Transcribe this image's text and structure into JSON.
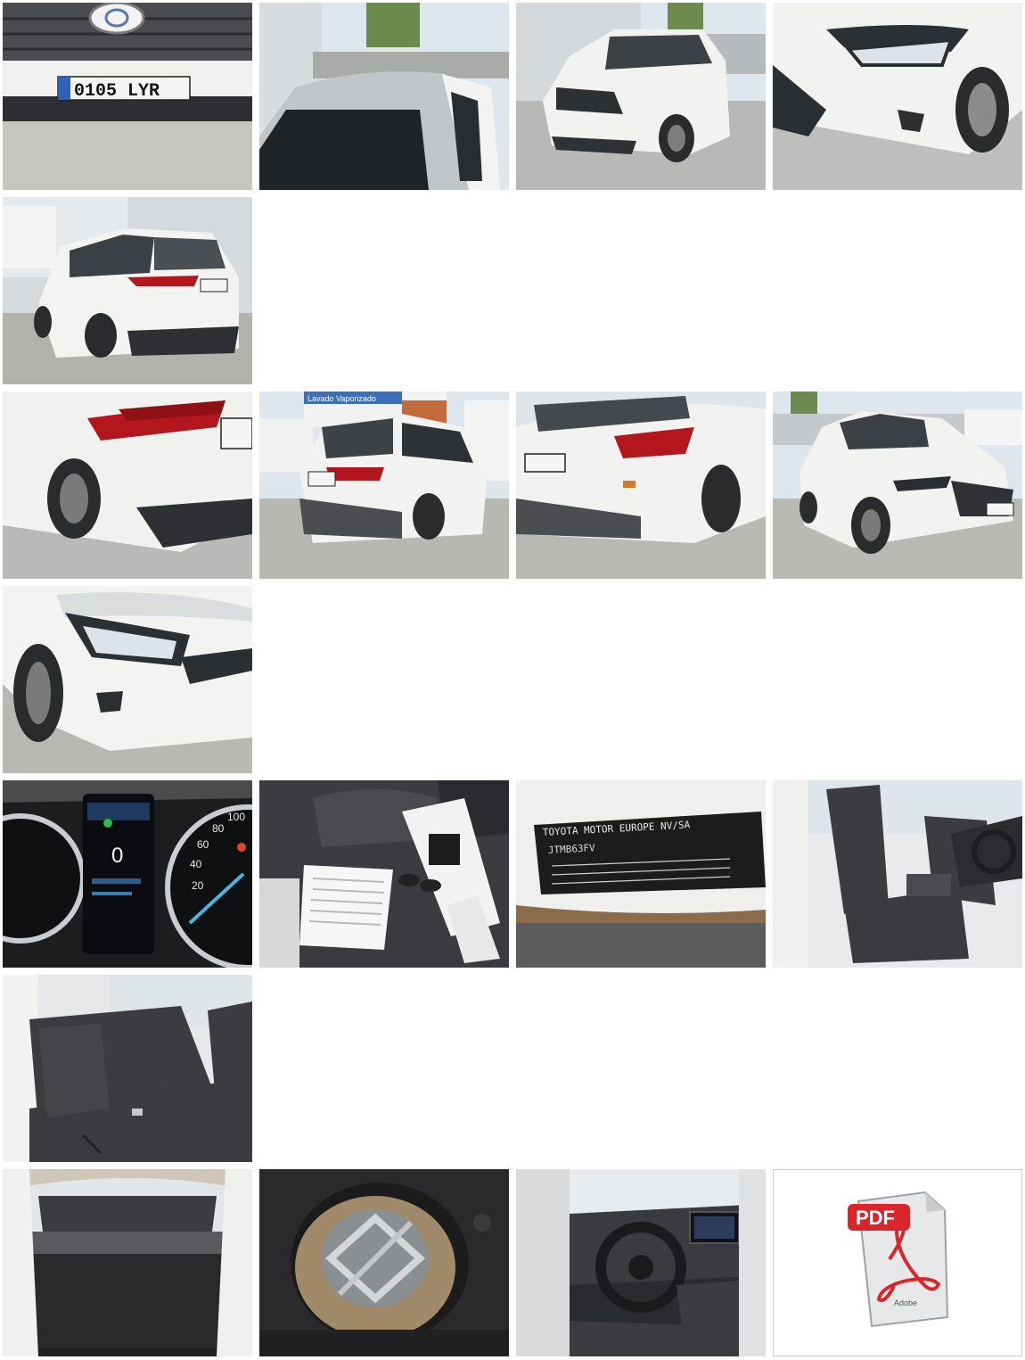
{
  "gallery": {
    "photos": [
      {
        "name": "photo-front-plate",
        "depicts": "front grille and license plate"
      },
      {
        "name": "photo-roof",
        "depicts": "roof and windshield"
      },
      {
        "name": "photo-front-three-quarter",
        "depicts": "white SUV front three-quarter view"
      },
      {
        "name": "photo-front-right-corner",
        "depicts": "front right headlight and bumper"
      },
      {
        "name": "photo-rear-left",
        "depicts": "rear left three-quarter view"
      },
      {
        "name": "photo-rear-right-corner",
        "depicts": "rear right taillight and bumper"
      },
      {
        "name": "photo-rear-yard",
        "depicts": "rear view in parking yard"
      },
      {
        "name": "photo-rear-close",
        "depicts": "rear bumper and taillight"
      },
      {
        "name": "photo-front-side",
        "depicts": "front three-quarter view in yard"
      },
      {
        "name": "photo-front-left-corner",
        "depicts": "front left corner close-up"
      },
      {
        "name": "photo-dashboard-cluster",
        "depicts": "instrument cluster"
      },
      {
        "name": "photo-documents-keys",
        "depicts": "documents and keys on seat"
      },
      {
        "name": "photo-vin-label",
        "depicts": "manufacturer identification plate"
      },
      {
        "name": "photo-front-seats",
        "depicts": "front seats interior"
      },
      {
        "name": "photo-rear-seats",
        "depicts": "rear seats interior"
      },
      {
        "name": "photo-trunk",
        "depicts": "open trunk"
      },
      {
        "name": "photo-spare-wheel",
        "depicts": "spare wheel well"
      },
      {
        "name": "photo-cockpit",
        "depicts": "steering wheel and center console"
      }
    ],
    "pdf_document": {
      "name": "pdf-document-link",
      "icon": "pdf-file-icon"
    }
  },
  "texts": {
    "plate_number": "0105 LYR",
    "dealer_sign": "Lavado Vaporizado",
    "vin_label_lines": [
      "TOYOTA MOTOR EUROPE NV/SA",
      "JTMB63FV"
    ],
    "pdf_badge": "PDF",
    "pdf_brand": "Adobe",
    "speedo_ticks": [
      "100",
      "80",
      "60",
      "40",
      "20"
    ],
    "cluster_speed": "0"
  },
  "colors": {
    "body_white": "#f4f4f2",
    "tarmac": "#b9bab7",
    "taillight_red": "#b3161d",
    "pdf_red": "#d8262a",
    "seat_dark": "#3b3b40",
    "sky": "#dfe7ee"
  }
}
